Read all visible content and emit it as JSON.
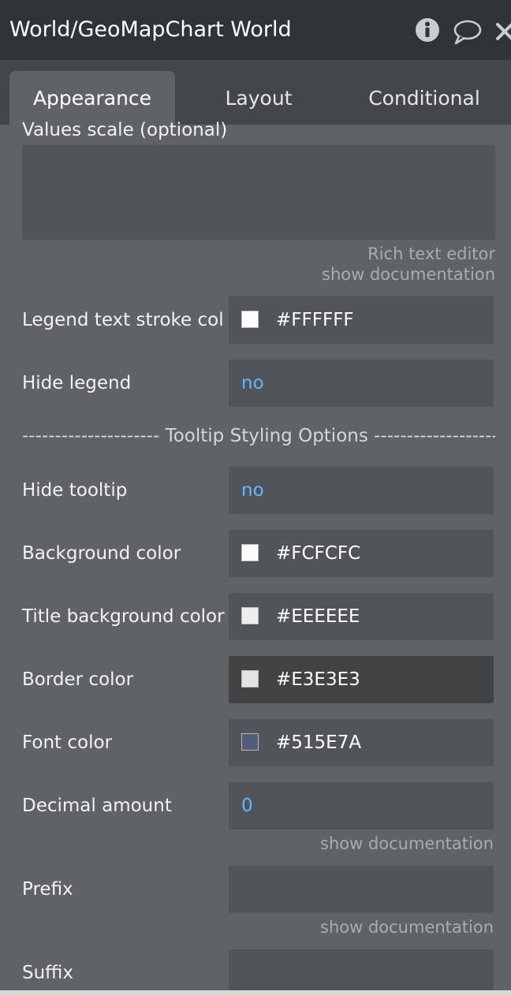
{
  "header": {
    "title": "World/GeoMapChart World"
  },
  "tabs": [
    {
      "label": "Appearance",
      "active": true
    },
    {
      "label": "Layout",
      "active": false
    },
    {
      "label": "Conditional",
      "active": false
    }
  ],
  "values_scale": {
    "label": "Values scale (optional)",
    "rich_text_link": "Rich text editor",
    "doc_link": "show documentation"
  },
  "legend_stroke": {
    "label": "Legend text stroke col",
    "color": "#FFFFFF",
    "hex": "#FFFFFF"
  },
  "hide_legend": {
    "label": "Hide legend",
    "value": "no"
  },
  "divider": "--------------------- Tooltip Styling Options --------------------",
  "hide_tooltip": {
    "label": "Hide tooltip",
    "value": "no"
  },
  "background_color": {
    "label": "Background color",
    "color": "#FCFCFC",
    "hex": "#FCFCFC"
  },
  "title_bg_color": {
    "label": "Title background color",
    "color": "#EEEEEE",
    "hex": "#EEEEEE"
  },
  "border_color": {
    "label": "Border color",
    "color": "#E3E3E3",
    "hex": "#E3E3E3"
  },
  "font_color": {
    "label": "Font color",
    "color": "#515E7A",
    "hex": "#515E7A"
  },
  "decimal_amount": {
    "label": "Decimal amount",
    "value": "0",
    "doc_link": "show documentation"
  },
  "prefix": {
    "label": "Prefix",
    "value": "",
    "doc_link": "show documentation"
  },
  "suffix": {
    "label": "Suffix",
    "value": ""
  }
}
